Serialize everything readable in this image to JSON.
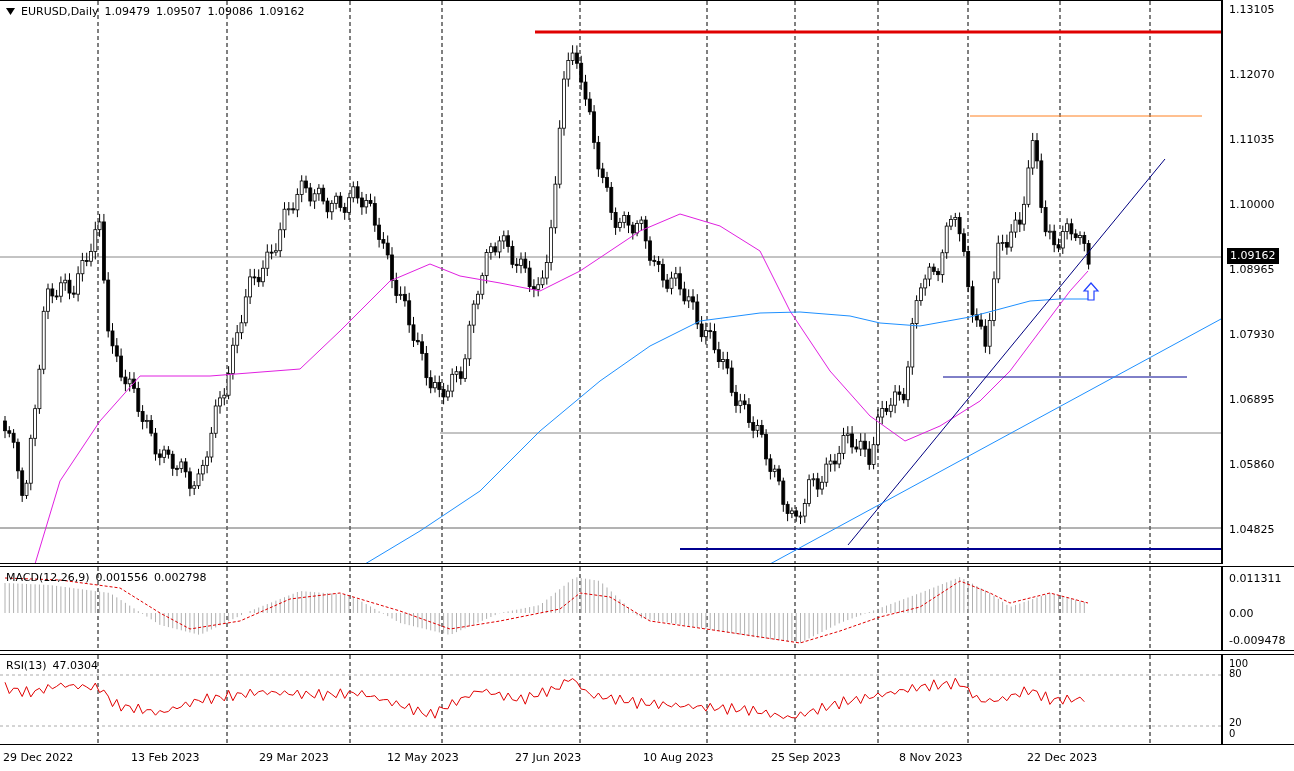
{
  "main_pane": {
    "symbol": "EURUSD,Daily",
    "ohlc": [
      "1.09479",
      "1.09507",
      "1.09086",
      "1.09162"
    ],
    "price_axis": [
      "1.13105",
      "1.12070",
      "1.11035",
      "1.10000",
      "1.08965",
      "1.07930",
      "1.06895",
      "1.05860",
      "1.04825"
    ],
    "current_price": "1.09162"
  },
  "macd_pane": {
    "title": "MACD(12,26,9)",
    "values": [
      "0.001556",
      "0.002798"
    ],
    "axis": [
      "0.011311",
      "0.00",
      "-0.009478"
    ]
  },
  "rsi_pane": {
    "title": "RSI(13)",
    "value": "47.0304",
    "axis": [
      "100",
      "80",
      "20",
      "0"
    ]
  },
  "time_axis": [
    "29 Dec 2022",
    "13 Feb 2023",
    "29 Mar 2023",
    "12 May 2023",
    "27 Jun 2023",
    "10 Aug 2023",
    "25 Sep 2023",
    "8 Nov 2023",
    "22 Dec 2023"
  ]
}
